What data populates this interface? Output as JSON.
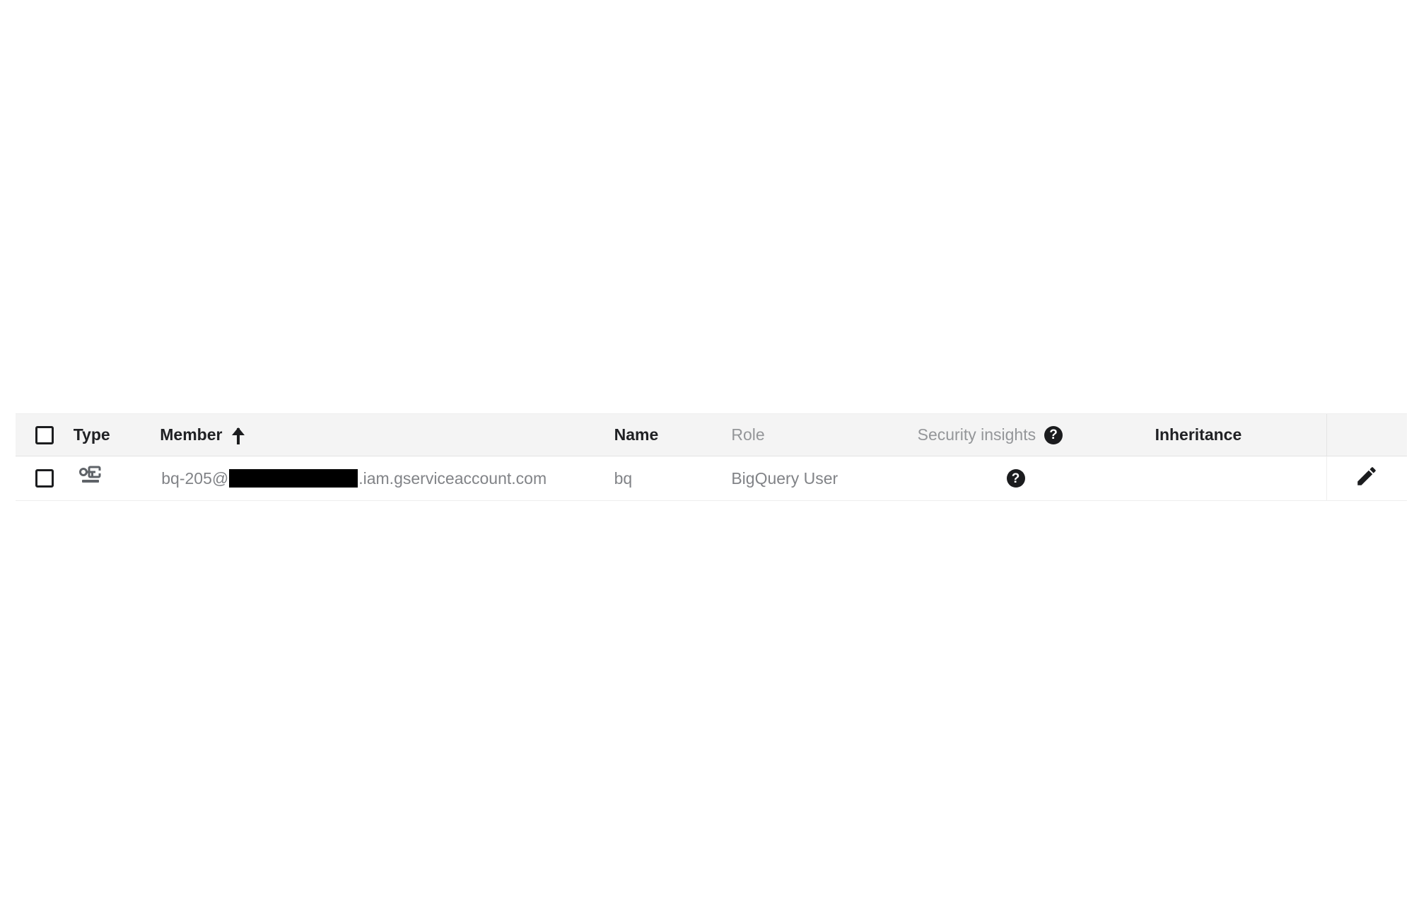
{
  "table": {
    "columns": [
      {
        "key": "select",
        "label": "",
        "style": "none"
      },
      {
        "key": "type",
        "label": "Type",
        "style": "dark"
      },
      {
        "key": "member",
        "label": "Member",
        "style": "dark",
        "sort": "ascending"
      },
      {
        "key": "name",
        "label": "Name",
        "style": "dark"
      },
      {
        "key": "role",
        "label": "Role",
        "style": "muted"
      },
      {
        "key": "security",
        "label": "Security insights",
        "style": "muted",
        "help": true
      },
      {
        "key": "inheritance",
        "label": "Inheritance",
        "style": "dark"
      },
      {
        "key": "actions",
        "label": "",
        "style": "none"
      }
    ],
    "header": {
      "select_all_checkbox": "unchecked",
      "type": "Type",
      "member": "Member",
      "member_sort_icon": "sort-ascending-arrow-icon",
      "name": "Name",
      "role": "Role",
      "security_insights": "Security insights",
      "security_insights_help_icon": "help-circle-icon",
      "inheritance": "Inheritance"
    },
    "rows": [
      {
        "checkbox": "unchecked",
        "type_icon": "service-account-key-icon",
        "member_prefix": "bq-205@",
        "member_redacted": "",
        "member_suffix": ".iam.gserviceaccount.com",
        "name": "bq",
        "role": "BigQuery User",
        "security_insights_icon": "help-circle-icon",
        "inheritance": "",
        "action_icon": "edit-pencil-icon"
      }
    ]
  },
  "colors": {
    "header_background": "#f4f4f4",
    "row_background": "#ffffff",
    "text_dark": "#202124",
    "text_muted": "#949699",
    "row_text": "#818387",
    "border": "#e4e4e4",
    "redaction": "#000000",
    "icon_dark": "#1b1c1e"
  }
}
